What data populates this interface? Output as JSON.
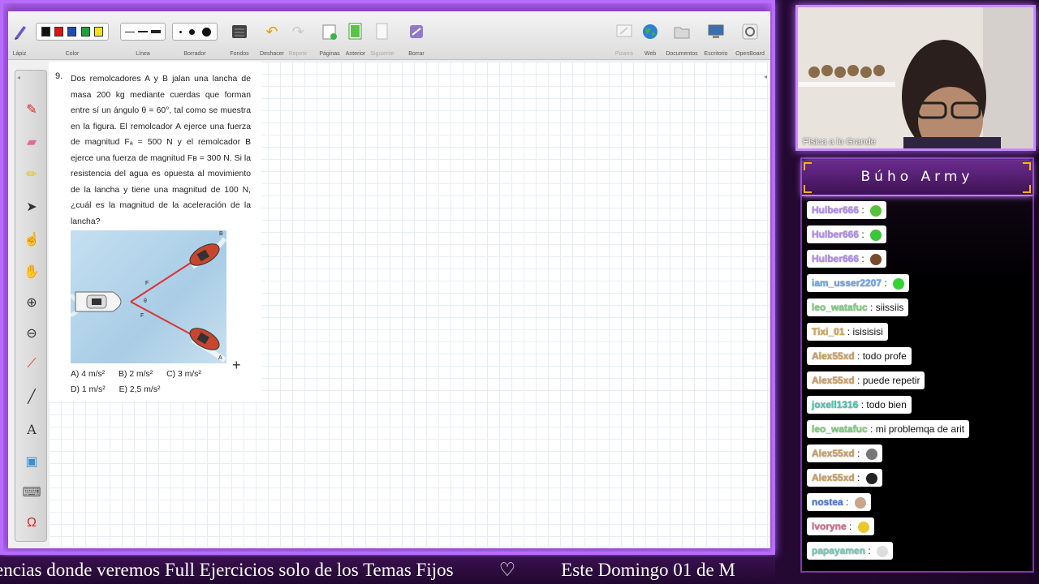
{
  "toolbar": {
    "items": [
      {
        "label": "Lápiz"
      },
      {
        "label": "Color"
      },
      {
        "label": "Línea"
      },
      {
        "label": "Borrador"
      },
      {
        "label": "Fondos"
      },
      {
        "label": "Deshacer"
      },
      {
        "label": "Repetir"
      },
      {
        "label": "Páginas"
      },
      {
        "label": "Anterior"
      },
      {
        "label": "Siguiente"
      },
      {
        "label": "Borrar"
      },
      {
        "label": "Pizarra"
      },
      {
        "label": "Web"
      },
      {
        "label": "Documentos"
      },
      {
        "label": "Escritorio"
      },
      {
        "label": "OpenBoard"
      }
    ],
    "colors": [
      "#111111",
      "#e01414",
      "#1b4fb5",
      "#1aa23a",
      "#f3e21a"
    ]
  },
  "problem": {
    "number": "9.",
    "text": "Dos remolcadores A y B jalan una lancha de masa 200 kg mediante cuerdas que forman entre sí un ángulo θ = 60°, tal como se muestra en la figura. El remolcador A ejerce una fuerza de magnitud Fₐ = 500 N y el remolcador B ejerce una fuerza de magnitud Fʙ = 300 N. Si la resistencia del agua es opuesta al movimiento de la lancha y tiene una magnitud de 100 N, ¿cuál es la magnitud de la aceleración de la lancha?",
    "figure": {
      "label_b": "B",
      "label_a": "A",
      "force_b": "F",
      "force_a": "F",
      "angle": "θ"
    },
    "answers": [
      "A) 4 m/s²",
      "B) 2 m/s²",
      "C) 3 m/s²",
      "D) 1 m/s²",
      "E) 2,5 m/s²"
    ]
  },
  "webcam": {
    "caption": "Física a lo Grande"
  },
  "chat": {
    "title": "Búho Army",
    "messages": [
      {
        "user": "Hulber666",
        "text": "",
        "emote": "#58c13a",
        "user_color": "#b98cff"
      },
      {
        "user": "Hulber666",
        "text": "",
        "emote": "#3cc43a",
        "user_color": "#b98cff"
      },
      {
        "user": "Hulber666",
        "text": "",
        "emote": "#7a4a2a",
        "user_color": "#b98cff"
      },
      {
        "user": "iam_usser2207",
        "text": "",
        "emote": "#35d235",
        "user_color": "#6aa9ff"
      },
      {
        "user": "leo_watafuc",
        "text": "siissiis",
        "emote": "",
        "user_color": "#7bd77b"
      },
      {
        "user": "Tixi_01",
        "text": "isisisisi",
        "emote": "",
        "user_color": "#e0a44a"
      },
      {
        "user": "Alex55xd",
        "text": "todo profe",
        "emote": "",
        "user_color": "#d6a35c"
      },
      {
        "user": "Alex55xd",
        "text": "puede repetir",
        "emote": "",
        "user_color": "#d6a35c"
      },
      {
        "user": "joxell1316",
        "text": "todo bien",
        "emote": "",
        "user_color": "#3fd0b7"
      },
      {
        "user": "leo_watafuc",
        "text": "mi problemqa de arit",
        "emote": "",
        "user_color": "#7bd77b"
      },
      {
        "user": "Alex55xd",
        "text": "",
        "emote": "#777777",
        "user_color": "#d6a35c"
      },
      {
        "user": "Alex55xd",
        "text": "",
        "emote": "#222222",
        "user_color": "#d6a35c"
      },
      {
        "user": "nostea",
        "text": "",
        "emote": "#c9a58a",
        "user_color": "#4a7fe0"
      },
      {
        "user": "lvoryne",
        "text": "",
        "emote": "#e8c82a",
        "user_color": "#e06a8a"
      },
      {
        "user": "papayamen",
        "text": "",
        "emote": "#dddddd",
        "user_color": "#6fd2c2"
      }
    ]
  },
  "ticker": {
    "text_left": "encias donde veremos Full Ejercicios solo de los Temas Fijos",
    "heart": "♡",
    "text_right": "Este Domingo 01 de M"
  }
}
